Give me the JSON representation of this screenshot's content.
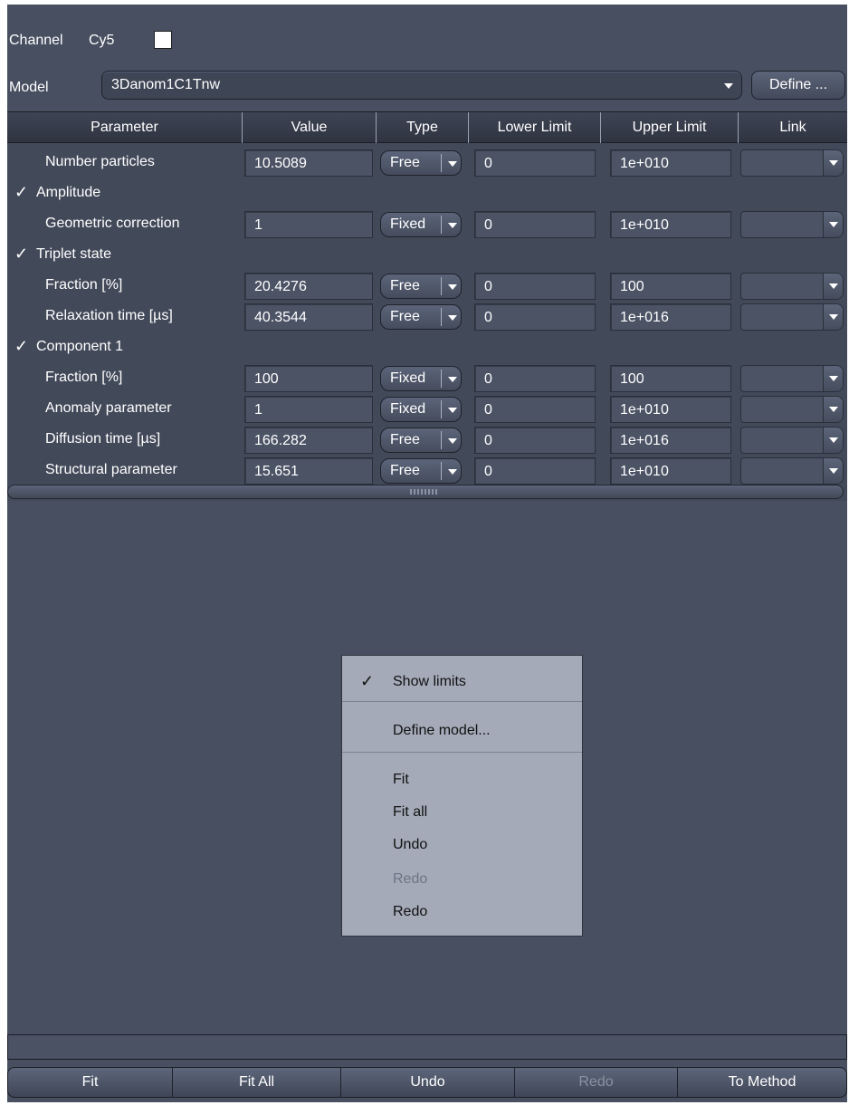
{
  "channel": {
    "label": "Channel",
    "value": "Cy5"
  },
  "model": {
    "label": "Model",
    "selected": "3Danom1C1Tnw",
    "define_button": "Define ..."
  },
  "table": {
    "headers": [
      "Parameter",
      "Value",
      "Type",
      "Lower Limit",
      "Upper Limit",
      "Link"
    ],
    "rows": [
      {
        "kind": "param",
        "name": "Number particles",
        "value": "10.5089",
        "type": "Free",
        "lower": "0",
        "upper": "1e+010",
        "link": ""
      },
      {
        "kind": "group",
        "name": "Amplitude",
        "checked": true
      },
      {
        "kind": "param",
        "name": "Geometric correction",
        "value": "1",
        "type": "Fixed",
        "lower": "0",
        "upper": "1e+010",
        "link": ""
      },
      {
        "kind": "group",
        "name": "Triplet state",
        "checked": true
      },
      {
        "kind": "param",
        "name": "Fraction [%]",
        "value": "20.4276",
        "type": "Free",
        "lower": "0",
        "upper": "100",
        "link": ""
      },
      {
        "kind": "param",
        "name": "Relaxation time [µs]",
        "value": "40.3544",
        "type": "Free",
        "lower": "0",
        "upper": "1e+016",
        "link": ""
      },
      {
        "kind": "group",
        "name": "Component 1",
        "checked": true
      },
      {
        "kind": "param",
        "name": "Fraction [%]",
        "value": "100",
        "type": "Fixed",
        "lower": "0",
        "upper": "100",
        "link": ""
      },
      {
        "kind": "param",
        "name": "Anomaly parameter",
        "value": "1",
        "type": "Fixed",
        "lower": "0",
        "upper": "1e+010",
        "link": ""
      },
      {
        "kind": "param",
        "name": "Diffusion time [µs]",
        "value": "166.282",
        "type": "Free",
        "lower": "0",
        "upper": "1e+016",
        "link": ""
      },
      {
        "kind": "param",
        "name": "Structural parameter",
        "value": "15.651",
        "type": "Free",
        "lower": "0",
        "upper": "1e+010",
        "link": ""
      }
    ]
  },
  "context_menu": {
    "show_limits": {
      "label": "Show limits",
      "checked": true
    },
    "define_model": "Define model...",
    "fit": "Fit",
    "fit_all": "Fit all",
    "undo": "Undo",
    "redo_disabled": "Redo",
    "redo": "Redo"
  },
  "bottom_buttons": {
    "fit": "Fit",
    "fit_all": "Fit All",
    "undo": "Undo",
    "redo": "Redo",
    "to_method": "To Method"
  },
  "colors": {
    "panel_bg": "#474f61",
    "menu_bg": "#a4aab8",
    "disabled_text": "#8a91a1"
  }
}
